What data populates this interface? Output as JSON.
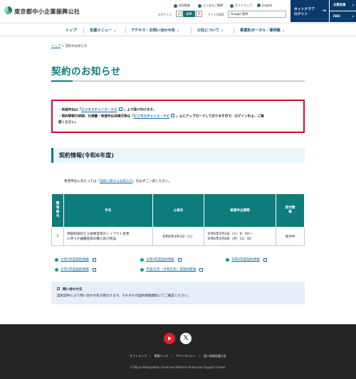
{
  "header": {
    "logo_text": "東京都中小企業振興公社",
    "utility": [
      "採用情報",
      "よくあるご質問",
      "サイトマップ",
      "English"
    ],
    "font_size_label": "文字サイズ",
    "font_size_options": [
      "小",
      "標準",
      "大"
    ],
    "search_label": "サイト内検索",
    "search_placeholder": "Google 提供",
    "login": {
      "line1": "ネットクラブ",
      "line2": "ログイン"
    },
    "side_buttons": [
      "企業会員",
      "FAQ"
    ]
  },
  "nav": [
    "トップ",
    "支援メニュー",
    "アクセス・お問い合わせ先",
    "公社について",
    "事業別ポータル・事例集"
  ],
  "breadcrumb": {
    "home": "トップ",
    "sep": ">",
    "current": "契約のお知らせ"
  },
  "page_title": "契約のお知らせ",
  "notice": {
    "line1_pre": "・希望申出は「",
    "line1_link": "ビジネスチャンス・ナビ",
    "line1_post": "」上で受け付けます。",
    "line2_pre": "・契約情報の詳細、仕様書・希望申出用様式等は「",
    "line2_link": "ビジネスチャンス・ナビ",
    "line2_post": "」上にアップロードしておりますので、ログインの上、ご確",
    "line3": "認ください。"
  },
  "section_title": "契約情報(令和6年度)",
  "intro": {
    "pre": "希望申出にあたっては「",
    "link": "契約に関するお知らせ",
    "post": "」を必ずご一読ください。"
  },
  "table": {
    "headers": [
      "整\n理\n番\n号",
      "件名",
      "公表日",
      "希望申出期間",
      "受付情\n報"
    ],
    "rows": [
      {
        "no": "1",
        "subject": "神田和泉町ビル執務室等のレイアウト変更\nに伴う什器備品等の購入及び移設",
        "published": "令和6年4月2日（火）",
        "period": "令和6年4月2日（火）9：00～\n令和6年4月8日（月）14：00",
        "status": "受付中"
      }
    ]
  },
  "past_links": [
    "令和5年度契約情報",
    "令和4年度契約情報",
    "令和3年度契約情報",
    "令和2年度契約情報",
    "平成31年（令和元年）度契約情報"
  ],
  "contact": {
    "heading": "問い合わせ先",
    "body": "契約案件により問い合わせ先が異なります。それぞれの契約情報資料にてご確認ください。"
  },
  "footer": {
    "social": [
      "youtube-icon",
      "x-icon"
    ],
    "links": [
      "サイトマップ",
      "関連リンク",
      "サイトポリシー",
      "個人情報保護方針"
    ],
    "copyright": "©Tokyo Metropolitan Small and Medium Enterprise Support Center"
  },
  "colors": {
    "brand_teal": "#0e7c7b",
    "navy": "#0b3b6b",
    "alert_red": "#c8102e",
    "link": "#0b6ba8"
  }
}
